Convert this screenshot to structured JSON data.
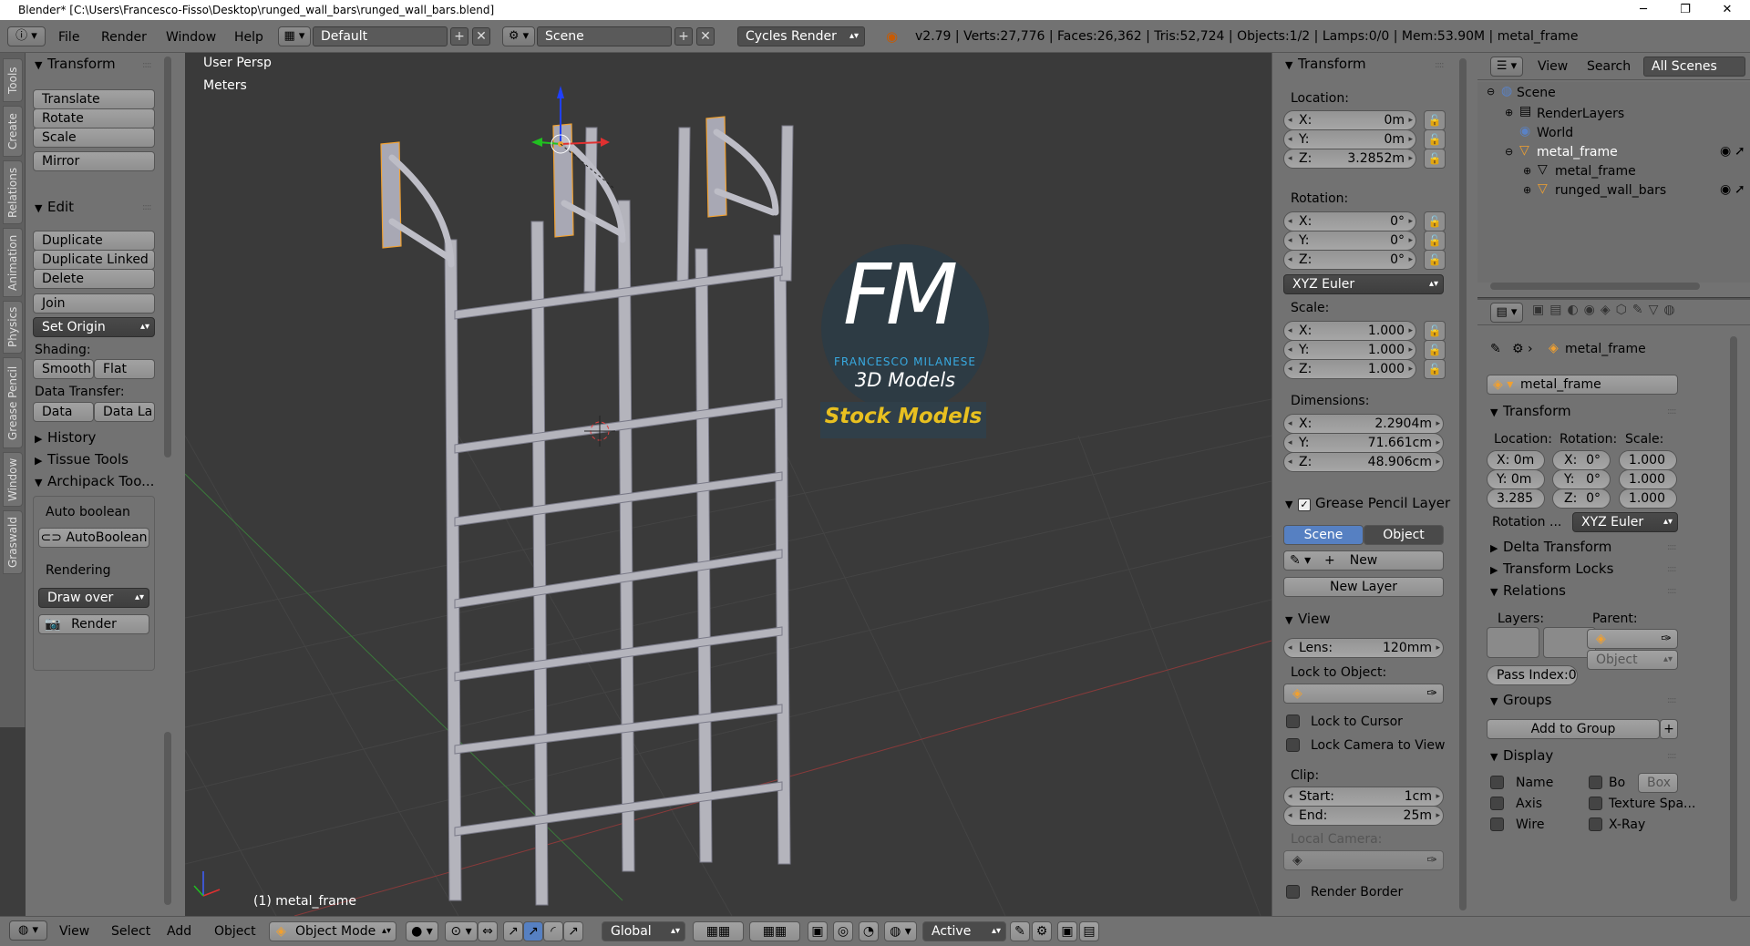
{
  "titlebar": {
    "title": "Blender* [C:\\Users\\Francesco-Fisso\\Desktop\\runged_wall_bars\\runged_wall_bars.blend]",
    "minimize": "─",
    "maximize": "❐",
    "close": "✕"
  },
  "topbar": {
    "menus": [
      "File",
      "Render",
      "Window",
      "Help"
    ],
    "layout": "Default",
    "scene": "Scene",
    "engine": "Cycles Render",
    "stats": "v2.79 | Verts:27,776 | Faces:26,362 | Tris:52,724 | Objects:1/2 | Lamps:0/0 | Mem:53.90M | metal_frame"
  },
  "left_tabs": [
    "Tools",
    "Create",
    "Relations",
    "Animation",
    "Physics",
    "Grease Pencil",
    "Window",
    "Graswald"
  ],
  "tools": {
    "transform_title": "Transform",
    "translate": "Translate",
    "rotate": "Rotate",
    "scale": "Scale",
    "mirror": "Mirror",
    "edit_title": "Edit",
    "duplicate": "Duplicate",
    "duplicate_linked": "Duplicate Linked",
    "delete": "Delete",
    "join": "Join",
    "set_origin": "Set Origin",
    "shading_label": "Shading:",
    "smooth": "Smooth",
    "flat": "Flat",
    "data_transfer_label": "Data Transfer:",
    "data": "Data",
    "data_la": "Data La",
    "history": "History",
    "tissue_tools": "Tissue Tools",
    "archipack": "Archipack Too...",
    "auto_boolean_label": "Auto boolean",
    "autoboolean_btn": "AutoBoolean",
    "rendering_label": "Rendering",
    "draw_over": "Draw over",
    "render_btn": "Render"
  },
  "viewport": {
    "persp": "User Persp",
    "units": "Meters",
    "object_label": "(1) metal_frame",
    "watermark_initials": "FM",
    "watermark_name": "FRANCESCO MILANESE",
    "watermark_sub": "3D Models",
    "watermark_banner": "Stock Models"
  },
  "npanel": {
    "transform_title": "Transform",
    "location_label": "Location:",
    "location": [
      {
        "k": "X:",
        "v": "0m"
      },
      {
        "k": "Y:",
        "v": "0m"
      },
      {
        "k": "Z:",
        "v": "3.2852m"
      }
    ],
    "rotation_label": "Rotation:",
    "rotation": [
      {
        "k": "X:",
        "v": "0°"
      },
      {
        "k": "Y:",
        "v": "0°"
      },
      {
        "k": "Z:",
        "v": "0°"
      }
    ],
    "rotation_mode": "XYZ Euler",
    "scale_label": "Scale:",
    "scale": [
      {
        "k": "X:",
        "v": "1.000"
      },
      {
        "k": "Y:",
        "v": "1.000"
      },
      {
        "k": "Z:",
        "v": "1.000"
      }
    ],
    "dimensions_label": "Dimensions:",
    "dimensions": [
      {
        "k": "X:",
        "v": "2.2904m"
      },
      {
        "k": "Y:",
        "v": "71.661cm"
      },
      {
        "k": "Z:",
        "v": "48.906cm"
      }
    ],
    "gp_title": "Grease Pencil Layer",
    "gp_scene": "Scene",
    "gp_object": "Object",
    "gp_new": "New",
    "gp_new_layer": "New Layer",
    "view_title": "View",
    "lens_k": "Lens:",
    "lens_v": "120mm",
    "lock_object_label": "Lock to Object:",
    "lock_cursor": "Lock to Cursor",
    "lock_camera": "Lock Camera to View",
    "clip_label": "Clip:",
    "clip_start_k": "Start:",
    "clip_start_v": "1cm",
    "clip_end_k": "End:",
    "clip_end_v": "25m",
    "local_camera": "Local Camera:",
    "render_border": "Render Border"
  },
  "outliner": {
    "view": "View",
    "search": "Search",
    "filter": "All Scenes",
    "items": [
      "Scene",
      "RenderLayers",
      "World",
      "metal_frame",
      "metal_frame",
      "runged_wall_bars"
    ]
  },
  "properties": {
    "object_path": "metal_frame",
    "object_name": "metal_frame",
    "transform_title": "Transform",
    "location_label": "Location:",
    "rotation_label": "Rotation:",
    "scale_label": "Scale:",
    "loc": [
      "X: 0m",
      "Y: 0m",
      "3.285"
    ],
    "rot": [
      "X:",
      "Y:",
      "Z:"
    ],
    "rot_v": [
      "0°",
      "0°",
      "0°"
    ],
    "scl": [
      "1.000",
      "1.000",
      "1.000"
    ],
    "rotation_mode_label": "Rotation ...",
    "rotation_mode": "XYZ Euler",
    "delta_transform": "Delta Transform",
    "transform_locks": "Transform Locks",
    "relations": "Relations",
    "layers_label": "Layers:",
    "parent_label": "Parent:",
    "parent_type": "Object",
    "pass_index": "Pass Index:0",
    "groups": "Groups",
    "add_to_group": "Add to Group",
    "display": "Display",
    "name": "Name",
    "bo": "Bo",
    "box": "Box",
    "axis": "Axis",
    "texture_space": "Texture Spa...",
    "wire": "Wire",
    "xray": "X-Ray"
  },
  "bottombar": {
    "menus": [
      "View",
      "Select",
      "Add",
      "Object"
    ],
    "mode": "Object Mode",
    "orientation": "Global",
    "pivot": "Active"
  },
  "colors": {
    "accent": "#5680c2",
    "selected_orange": "#f0a030",
    "viewport_bg": "#3a3a3a",
    "panel": "#727272"
  }
}
